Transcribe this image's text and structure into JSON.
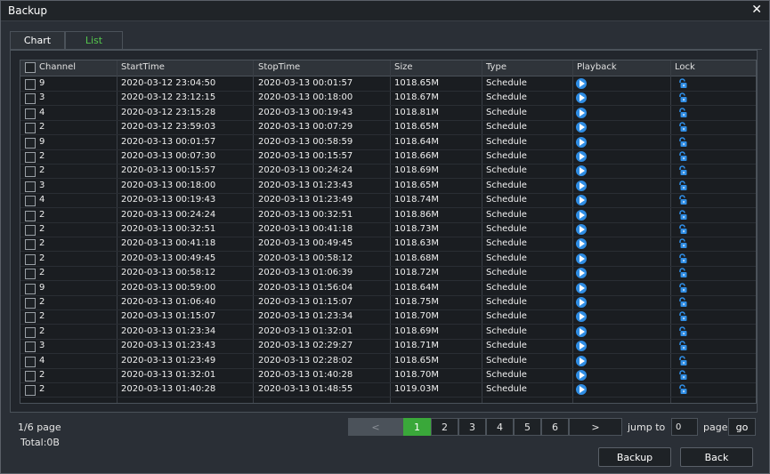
{
  "window": {
    "title": "Backup",
    "close_glyph": "✕"
  },
  "tabs": [
    {
      "label": "Chart",
      "active": false
    },
    {
      "label": "List",
      "active": true
    }
  ],
  "table": {
    "headers": [
      "Channel",
      "StartTime",
      "StopTime",
      "Size",
      "Type",
      "Playback",
      "Lock"
    ],
    "rows": [
      [
        "9",
        "2020-03-12 23:04:50",
        "2020-03-13 00:01:57",
        "1018.65M",
        "Schedule"
      ],
      [
        "3",
        "2020-03-12 23:12:15",
        "2020-03-13 00:18:00",
        "1018.67M",
        "Schedule"
      ],
      [
        "4",
        "2020-03-12 23:15:28",
        "2020-03-13 00:19:43",
        "1018.81M",
        "Schedule"
      ],
      [
        "2",
        "2020-03-12 23:59:03",
        "2020-03-13 00:07:29",
        "1018.65M",
        "Schedule"
      ],
      [
        "9",
        "2020-03-13 00:01:57",
        "2020-03-13 00:58:59",
        "1018.64M",
        "Schedule"
      ],
      [
        "2",
        "2020-03-13 00:07:30",
        "2020-03-13 00:15:57",
        "1018.66M",
        "Schedule"
      ],
      [
        "2",
        "2020-03-13 00:15:57",
        "2020-03-13 00:24:24",
        "1018.69M",
        "Schedule"
      ],
      [
        "3",
        "2020-03-13 00:18:00",
        "2020-03-13 01:23:43",
        "1018.65M",
        "Schedule"
      ],
      [
        "4",
        "2020-03-13 00:19:43",
        "2020-03-13 01:23:49",
        "1018.74M",
        "Schedule"
      ],
      [
        "2",
        "2020-03-13 00:24:24",
        "2020-03-13 00:32:51",
        "1018.86M",
        "Schedule"
      ],
      [
        "2",
        "2020-03-13 00:32:51",
        "2020-03-13 00:41:18",
        "1018.73M",
        "Schedule"
      ],
      [
        "2",
        "2020-03-13 00:41:18",
        "2020-03-13 00:49:45",
        "1018.63M",
        "Schedule"
      ],
      [
        "2",
        "2020-03-13 00:49:45",
        "2020-03-13 00:58:12",
        "1018.68M",
        "Schedule"
      ],
      [
        "2",
        "2020-03-13 00:58:12",
        "2020-03-13 01:06:39",
        "1018.72M",
        "Schedule"
      ],
      [
        "9",
        "2020-03-13 00:59:00",
        "2020-03-13 01:56:04",
        "1018.64M",
        "Schedule"
      ],
      [
        "2",
        "2020-03-13 01:06:40",
        "2020-03-13 01:15:07",
        "1018.75M",
        "Schedule"
      ],
      [
        "2",
        "2020-03-13 01:15:07",
        "2020-03-13 01:23:34",
        "1018.70M",
        "Schedule"
      ],
      [
        "2",
        "2020-03-13 01:23:34",
        "2020-03-13 01:32:01",
        "1018.69M",
        "Schedule"
      ],
      [
        "3",
        "2020-03-13 01:23:43",
        "2020-03-13 02:29:27",
        "1018.71M",
        "Schedule"
      ],
      [
        "4",
        "2020-03-13 01:23:49",
        "2020-03-13 02:28:02",
        "1018.65M",
        "Schedule"
      ],
      [
        "2",
        "2020-03-13 01:32:01",
        "2020-03-13 01:40:28",
        "1018.70M",
        "Schedule"
      ],
      [
        "2",
        "2020-03-13 01:40:28",
        "2020-03-13 01:48:55",
        "1019.03M",
        "Schedule"
      ]
    ]
  },
  "footer": {
    "page_info": "1/6 page",
    "total": "Total:0B",
    "prev": "<",
    "next": ">",
    "pages": [
      "1",
      "2",
      "3",
      "4",
      "5",
      "6"
    ],
    "current_page": "1",
    "jump_to": "jump to",
    "jump_value": "0",
    "page_label": "page",
    "go": "go",
    "backup": "Backup",
    "back": "Back"
  },
  "colors": {
    "active_tab_text": "#55c64d",
    "active_page": "#3aa83a",
    "playback_icon": "#2f8de4",
    "lock_icon": "#2f8de4"
  },
  "icons": {
    "playback": "play-circle-icon",
    "lock": "unlock-icon",
    "close": "close-icon"
  }
}
